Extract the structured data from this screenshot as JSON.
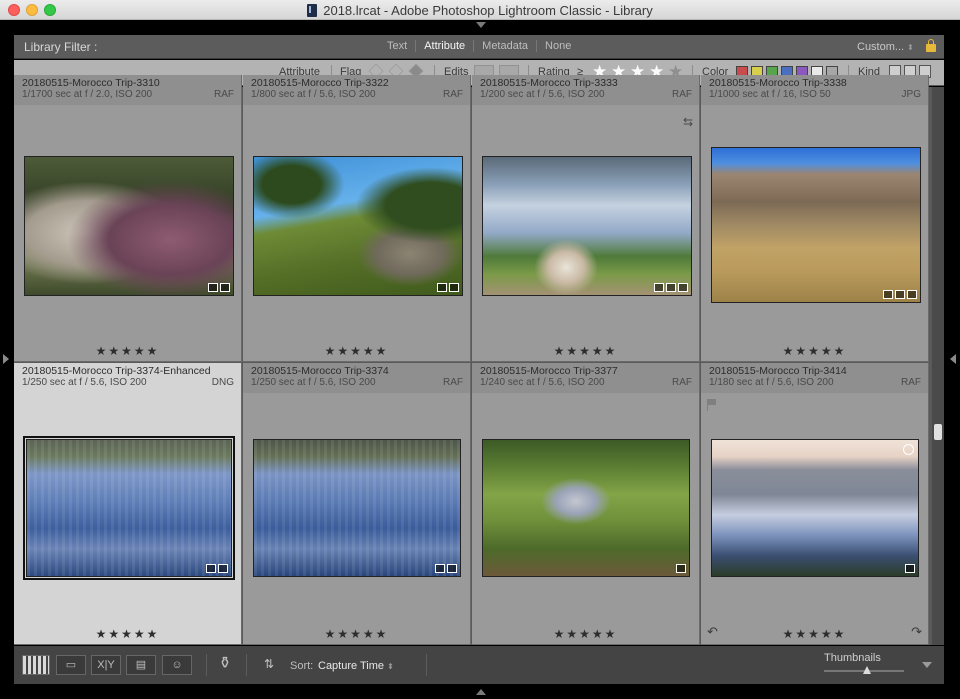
{
  "window": {
    "title": "2018.lrcat - Adobe Photoshop Lightroom Classic - Library"
  },
  "filter_bar": {
    "label": "Library Filter :",
    "tabs": [
      "Text",
      "Attribute",
      "Metadata",
      "None"
    ],
    "active_tab": "Attribute",
    "preset": "Custom...",
    "lock_icon": "lock-icon"
  },
  "attribute_bar": {
    "title": "Attribute",
    "flag_label": "Flag",
    "edits_label": "Edits",
    "rating_label": "Rating",
    "rating_operator": "≥",
    "rating_stars": 4,
    "rating_max": 5,
    "color_label": "Color",
    "color_swatches": [
      "#c94b4b",
      "#d8cf4d",
      "#58a54d",
      "#4a6fc1",
      "#8b58bd",
      "#e9e9e9",
      "#a7a7a7"
    ],
    "kind_label": "Kind"
  },
  "grid": {
    "cells": [
      {
        "name": "20180515-Morocco Trip-3310",
        "info": "1/1700 sec at f / 2.0, ISO 200",
        "ext": "RAF",
        "stars": "★★★★★",
        "selected": false
      },
      {
        "name": "20180515-Morocco Trip-3322",
        "info": "1/800 sec at f / 5.6, ISO 200",
        "ext": "RAF",
        "stars": "★★★★★",
        "selected": false
      },
      {
        "name": "20180515-Morocco Trip-3333",
        "info": "1/200 sec at f / 5.6, ISO 200",
        "ext": "RAF",
        "stars": "★★★★★",
        "selected": false
      },
      {
        "name": "20180515-Morocco Trip-3338",
        "info": "1/1000 sec at f / 16, ISO 50",
        "ext": "JPG",
        "stars": "★★★★★",
        "selected": false
      },
      {
        "name": "20180515-Morocco Trip-3374-Enhanced",
        "info": "1/250 sec at f / 5.6, ISO 200",
        "ext": "DNG",
        "stars": "★★★★★",
        "selected": true
      },
      {
        "name": "20180515-Morocco Trip-3374",
        "info": "1/250 sec at f / 5.6, ISO 200",
        "ext": "RAF",
        "stars": "★★★★★",
        "selected": false
      },
      {
        "name": "20180515-Morocco Trip-3377",
        "info": "1/240 sec at f / 5.6, ISO 200",
        "ext": "RAF",
        "stars": "★★★★★",
        "selected": false
      },
      {
        "name": "20180515-Morocco Trip-3414",
        "info": "1/180 sec at f / 5.6, ISO 200",
        "ext": "RAF",
        "stars": "★★★★★",
        "selected": false
      }
    ]
  },
  "toolbar": {
    "sort_label": "Sort:",
    "sort_value": "Capture Time",
    "thumbnails_label": "Thumbnails",
    "thumbnail_size": 0.5,
    "views": [
      "grid-view-icon",
      "loupe-view-icon",
      "compare-view-icon",
      "survey-view-icon",
      "people-view-icon"
    ],
    "compare_label": "X|Y"
  },
  "colors": {
    "filter_bar_bg": "#5c5c5c",
    "grid_cell_bg": "#9a9a9a",
    "selected_cell_bg": "#d4d4d4",
    "toolbar_bg": "#444444",
    "lock": "#e7b93b"
  }
}
